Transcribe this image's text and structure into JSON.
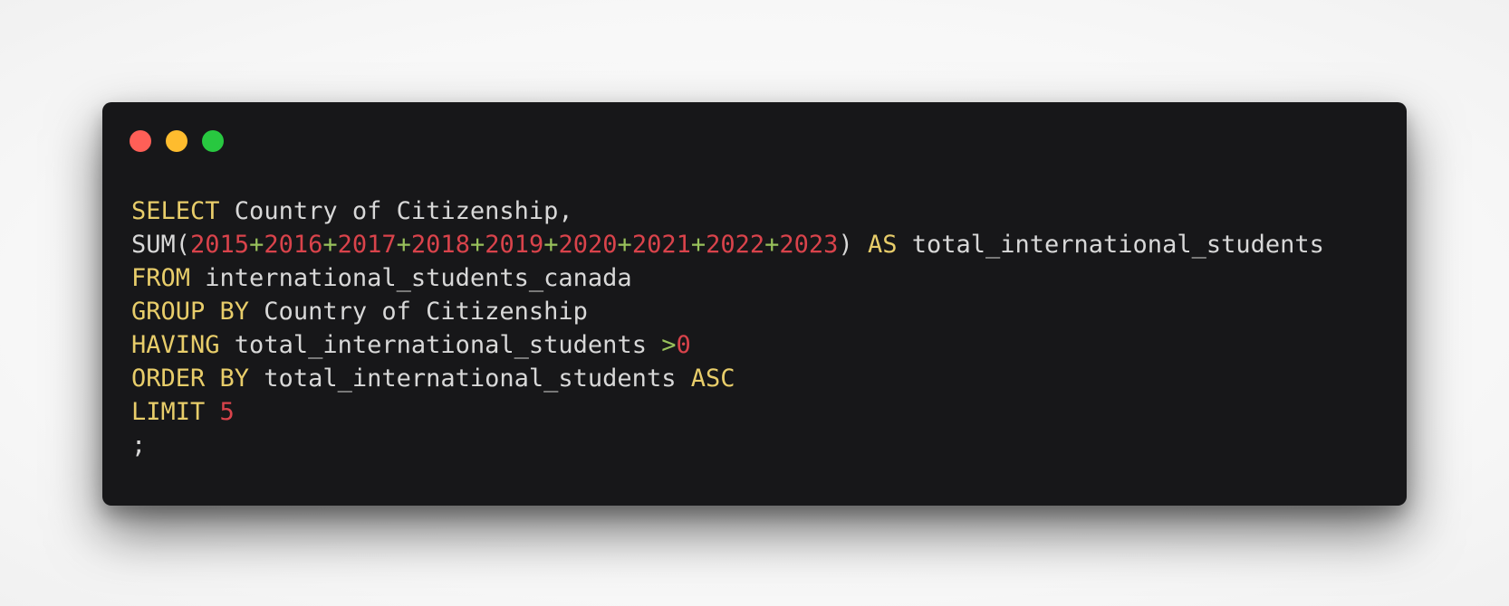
{
  "window": {
    "controls": {
      "close_color": "#ff5f57",
      "minimize_color": "#febc2e",
      "maximize_color": "#28c840"
    }
  },
  "theme": {
    "background": "#171719",
    "keyword_color": "#e8cd6a",
    "number_color": "#d9434b",
    "operator_color": "#98c15b",
    "text_color": "#d8d8d8"
  },
  "code": {
    "language": "SQL",
    "lines": [
      [
        {
          "t": "kw",
          "v": "SELECT"
        },
        {
          "t": "txt",
          "v": " Country of Citizenship,"
        }
      ],
      [
        {
          "t": "txt",
          "v": "SUM("
        },
        {
          "t": "num",
          "v": "2015"
        },
        {
          "t": "op",
          "v": "+"
        },
        {
          "t": "num",
          "v": "2016"
        },
        {
          "t": "op",
          "v": "+"
        },
        {
          "t": "num",
          "v": "2017"
        },
        {
          "t": "op",
          "v": "+"
        },
        {
          "t": "num",
          "v": "2018"
        },
        {
          "t": "op",
          "v": "+"
        },
        {
          "t": "num",
          "v": "2019"
        },
        {
          "t": "op",
          "v": "+"
        },
        {
          "t": "num",
          "v": "2020"
        },
        {
          "t": "op",
          "v": "+"
        },
        {
          "t": "num",
          "v": "2021"
        },
        {
          "t": "op",
          "v": "+"
        },
        {
          "t": "num",
          "v": "2022"
        },
        {
          "t": "op",
          "v": "+"
        },
        {
          "t": "num",
          "v": "2023"
        },
        {
          "t": "txt",
          "v": ") "
        },
        {
          "t": "kw",
          "v": "AS"
        },
        {
          "t": "txt",
          "v": " total_international_students"
        }
      ],
      [
        {
          "t": "kw",
          "v": "FROM"
        },
        {
          "t": "txt",
          "v": " international_students_canada"
        }
      ],
      [
        {
          "t": "kw",
          "v": "GROUP BY"
        },
        {
          "t": "txt",
          "v": " Country of Citizenship"
        }
      ],
      [
        {
          "t": "kw",
          "v": "HAVING"
        },
        {
          "t": "txt",
          "v": " total_international_students "
        },
        {
          "t": "op",
          "v": ">"
        },
        {
          "t": "num",
          "v": "0"
        }
      ],
      [
        {
          "t": "kw",
          "v": "ORDER BY"
        },
        {
          "t": "txt",
          "v": " total_international_students "
        },
        {
          "t": "kw",
          "v": "ASC"
        }
      ],
      [
        {
          "t": "kw",
          "v": "LIMIT"
        },
        {
          "t": "txt",
          "v": " "
        },
        {
          "t": "num",
          "v": "5"
        }
      ],
      [
        {
          "t": "txt",
          "v": ";"
        }
      ]
    ]
  }
}
